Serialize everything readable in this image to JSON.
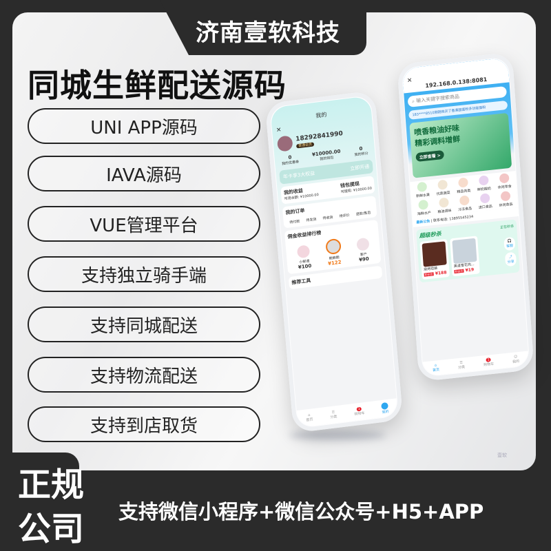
{
  "brand": "济南壹软科技",
  "headline": "同城生鲜配送源码",
  "features": [
    "UNI APP源码",
    "IAVA源码",
    "VUE管理平台",
    "支持独立骑手端",
    "支持同城配送",
    "支持物流配送",
    "支持到店取货"
  ],
  "badge": [
    "正规",
    "公司"
  ],
  "slogan": "支持微信小程序+微信公众号+H5+APP",
  "watermark": "壹软",
  "phone_profile": {
    "title": "我的",
    "phone": "18292841990",
    "level": "普通会员",
    "stats": [
      {
        "value": "0",
        "label": "我的优惠券"
      },
      {
        "value": "¥10000.00",
        "label": "我的钱包"
      },
      {
        "value": "0",
        "label": "我的积分"
      }
    ],
    "vip_text": "年卡享3大权益",
    "vip_action": "立即开通",
    "earnings": {
      "label": "我的收益",
      "sub": "可用余额: ¥10000.00"
    },
    "withdraw": {
      "label": "钱包提现",
      "sub": "可提现: ¥10000.00"
    },
    "orders_title": "我的订单",
    "orders": [
      "待付款",
      "待发货",
      "待收货",
      "待评价",
      "退款/售后"
    ],
    "ranking_title": "佣金收益排行榜",
    "ranking": [
      {
        "name": "小邮递",
        "amount": "¥100"
      },
      {
        "name": "鲍鲍鲍",
        "amount": "¥122"
      },
      {
        "name": "客户",
        "amount": "¥90"
      }
    ],
    "tools_title": "推荐工具",
    "tabs": [
      "首页",
      "分类",
      "购物车",
      "我的"
    ],
    "cart_badge": "1"
  },
  "phone_home": {
    "url": "192.168.0.138:8081",
    "search_placeholder": "输入关键字搜索商品",
    "notice": "183****8510刚刚购买了香满园面粉多功能面粉",
    "banner": [
      "喷香粮油好味",
      "精彩调料增鲜"
    ],
    "banner_btn": "立即查看 >",
    "categories": [
      "新鲜水果",
      "优质蔬菜",
      "精品肉类",
      "鲜奶酸奶",
      "休闲零食",
      "海鲜水产",
      "粮油调味",
      "冷冻食品",
      "进口食品",
      "休闲食品"
    ],
    "announce_label": "最新公告",
    "announce_text": "联系电话: 13895545234",
    "flash_title": "超级秒杀",
    "flash_more": "正在秒杀",
    "products": [
      {
        "name": "烧烤组装",
        "tag": "秒杀价",
        "price": "¥188"
      },
      {
        "name": "黑道雪花肉...",
        "tag": "秒杀价",
        "price": "¥19"
      }
    ],
    "side": [
      "客服",
      "分享"
    ],
    "tabs": [
      "首页",
      "分类",
      "购物车",
      "我的"
    ],
    "cart_badge": "1"
  },
  "colors": {
    "dark": "#2b2b2b",
    "blue": "#2ea7f0",
    "green": "#1c9a58",
    "orange": "#f07a1a",
    "red": "#e8212c"
  }
}
